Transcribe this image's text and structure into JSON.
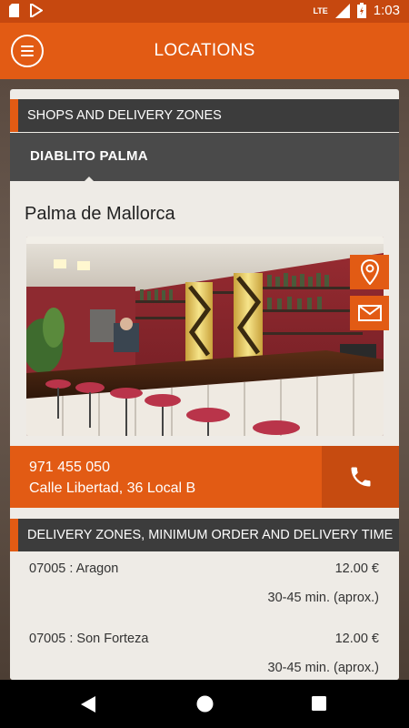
{
  "status_bar": {
    "time": "1:03",
    "network": "LTE",
    "left_icons": [
      "sd-card-icon",
      "play-store-icon"
    ],
    "right_icons": [
      "signal-icon",
      "battery-icon"
    ]
  },
  "app_bar": {
    "title": "LOCATIONS",
    "menu_icon": "menu-icon"
  },
  "shops": {
    "header": "SHOPS AND DELIVERY ZONES",
    "tabs": [
      {
        "label": "DIABLITO PALMA",
        "selected": true
      }
    ],
    "city": "Palma de Mallorca",
    "photo_icons": [
      "location-pin-icon",
      "email-icon"
    ],
    "phone": "971 455 050",
    "address": "Calle Libertad, 36 Local B",
    "call_icon": "phone-icon"
  },
  "delivery": {
    "header": "DELIVERY ZONES, MINIMUM ORDER AND DELIVERY TIME",
    "zones": [
      {
        "name": "07005 : Aragon",
        "price": "12.00 €",
        "time": "30-45 min. (aprox.)"
      },
      {
        "name": "07005 : Son Forteza",
        "price": "12.00 €",
        "time": "30-45 min. (aprox.)"
      }
    ]
  },
  "colors": {
    "accent": "#e25b14",
    "status_bar": "#c6480f",
    "header_dark": "#3c3c3c",
    "card_bg": "#eeebe6"
  },
  "nav_bar": {
    "icons": [
      "back-icon",
      "home-icon",
      "recents-icon"
    ]
  }
}
